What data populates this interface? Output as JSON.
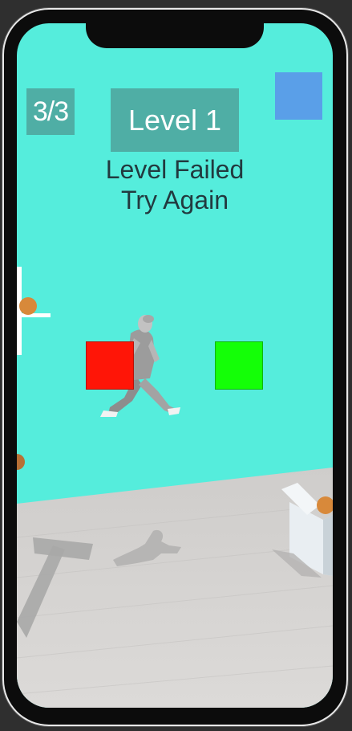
{
  "hud": {
    "attempts": "3/3",
    "level_label": "Level 1",
    "status_line1": "Level Failed",
    "status_line2": "Try Again"
  },
  "targets": {
    "left_color": "#ff1507",
    "right_color": "#14ff07"
  },
  "colors": {
    "sky": "#55eddc",
    "badge": "#4faea5",
    "menu_button": "#5a9fe8",
    "floor": "#d4d2d0"
  }
}
